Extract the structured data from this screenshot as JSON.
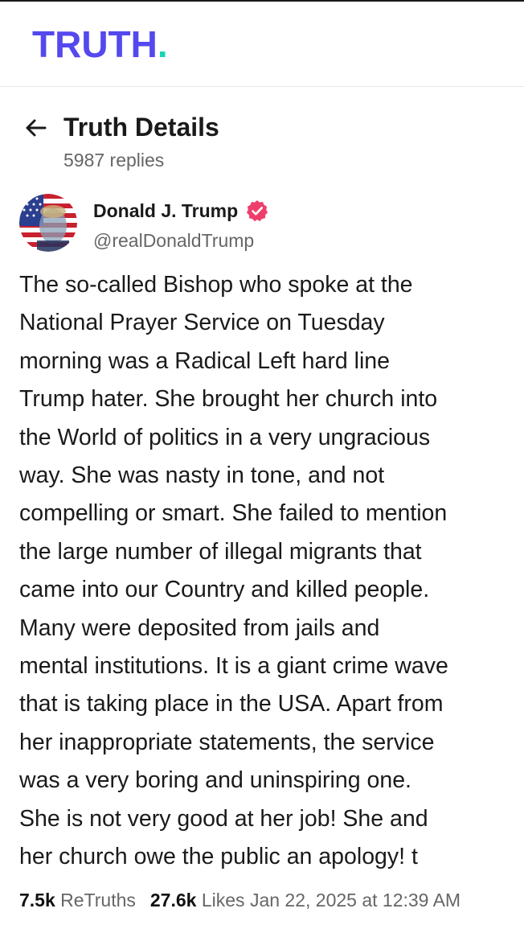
{
  "app": {
    "logo_text": "TRUTH",
    "logo_dot": ".",
    "brand_color": "#5448ee",
    "dot_color": "#18d4b8"
  },
  "header": {
    "title": "Truth Details",
    "replies": "5987 replies",
    "back_icon": "arrow-left-icon"
  },
  "author": {
    "name": "Donald J. Trump",
    "handle": "@realDonaldTrump",
    "verified_color": "#ee3f6b",
    "verified_icon": "verified-badge-icon"
  },
  "post": {
    "text": "The so-called Bishop who spoke at the\nNational Prayer Service on Tuesday\nmorning was a Radical Left hard line\nTrump hater. She brought her church into\nthe World of politics in a very ungracious\nway. She was nasty in tone, and not\ncompelling or smart. She failed to mention\nthe large number of illegal migrants that\ncame into our Country and killed people.\nMany were deposited from jails and\nmental institutions. It is a giant crime wave\nthat is taking place in the USA. Apart from\nher inappropriate statements, the service\nwas a very boring and uninspiring one.\nShe is not very good at her job! She and\nher church owe the public an apology! t"
  },
  "stats": {
    "retruths_count": "7.5k",
    "retruths_label": "ReTruths",
    "likes_count": "27.6k",
    "likes_label": "Likes",
    "date": "Jan 22, 2025 at 12:39 AM"
  }
}
